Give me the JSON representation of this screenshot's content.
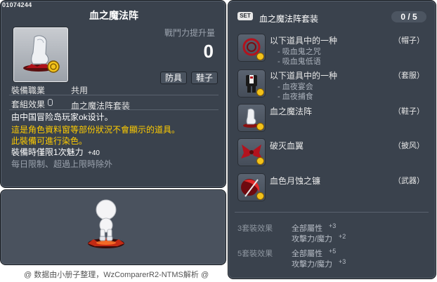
{
  "item": {
    "id": "01074244",
    "title": "血之魔法阵",
    "power_label": "戰鬥力提升量",
    "power_value": "0",
    "tags": [
      "防具",
      "鞋子"
    ],
    "job_label": "裝備職業",
    "job_value": "共用",
    "set_label": "套組效果",
    "set_value": "血之魔法阵套装",
    "desc_lines": [
      "由中国冒险岛玩家ok设计。",
      "這是角色資料窗等部份狀況不會顯示的道具。",
      "此裝備可進行染色。",
      "裝備時僅限1次魅力 +40",
      "每日限制、超過上限時除外"
    ],
    "charm_label": "裝備時僅限1次魅力",
    "charm_value": "+40"
  },
  "set": {
    "badge": "SET",
    "name": "血之魔法阵套装",
    "count": "0 / 5",
    "items": [
      {
        "icon": "red-whip-icon",
        "name": "以下道具中的一种",
        "subs": [
          "- 吸血鬼之咒",
          "- 吸血鬼低语"
        ],
        "cat": "（帽子）"
      },
      {
        "icon": "suit-icon",
        "name": "以下道具中的一种",
        "subs": [
          "- 血夜宴会",
          "- 血夜捕食"
        ],
        "cat": "（套服）"
      },
      {
        "icon": "boot-icon",
        "name": "血之魔法阵",
        "subs": [],
        "cat": "（鞋子）"
      },
      {
        "icon": "red-wings-icon",
        "name": "破灭血翼",
        "subs": [],
        "cat": "（披风）"
      },
      {
        "icon": "red-scythe-icon",
        "name": "血色月蚀之镰",
        "subs": [],
        "cat": "（武器）"
      }
    ],
    "effects": [
      {
        "label": "3套裝效果",
        "lines": [
          [
            "全部屬性",
            "+3"
          ],
          [
            "攻擊力/魔力",
            "+2"
          ]
        ]
      },
      {
        "label": "5套裝效果",
        "lines": [
          [
            "全部屬性",
            "+5"
          ],
          [
            "攻擊力/魔力",
            "+3"
          ]
        ]
      }
    ]
  },
  "footer": "@ 数据由小册子整理，WzComparerR2-NTMS解析 @"
}
